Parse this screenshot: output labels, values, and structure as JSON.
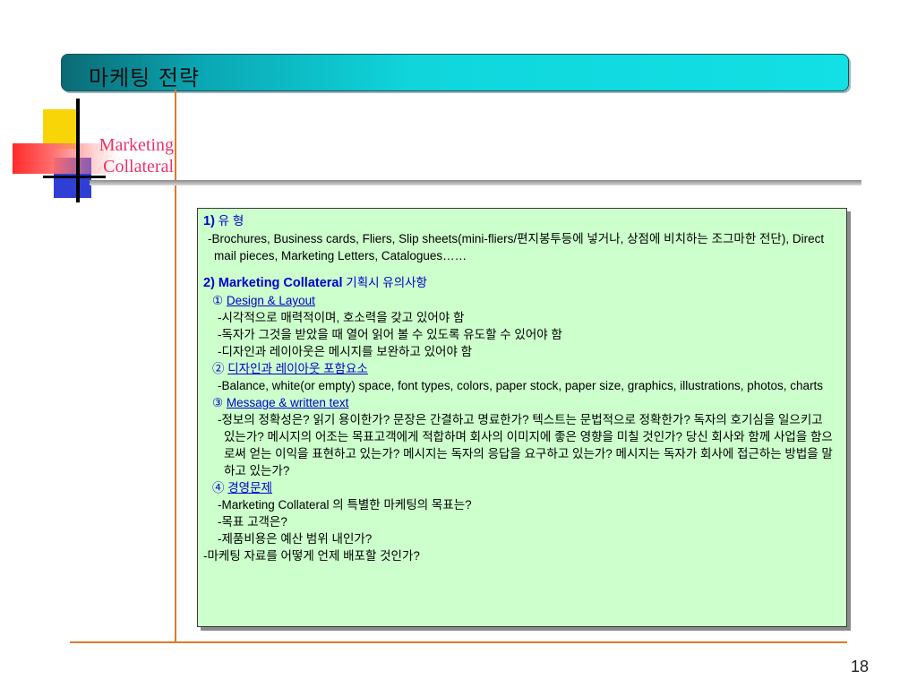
{
  "slide": {
    "title": "마케팅 전략",
    "logo_line1": "Marketing",
    "logo_line2": "Collateral",
    "page_number": "18"
  },
  "content": {
    "s1_num": "1)",
    "s1_title": "유  형",
    "s1_body": "-Brochures, Business cards, Fliers, Slip sheets(mini-fliers/편지봉투등에 넣거나, 상점에 비치하는 조그마한 전단), Direct mail pieces, Marketing Letters, Catalogues……",
    "s2_title": "2) Marketing Collateral",
    "s2_title_k": "기획시 유의사항",
    "sub1_num": "①",
    "sub1_label": "Design & Layout",
    "sub1_lines": [
      "-시각적으로 매력적이며, 호소력을 갖고 있어야 함",
      "-독자가 그것을 받았을 때 열어 읽어 볼 수 있도록 유도할 수 있어야 함",
      "-디자인과 레이아웃은 메시지를 보완하고 있어야 함"
    ],
    "sub2_num": "②",
    "sub2_label": "디자인과 레이아웃 포함요소",
    "sub2_body": "-Balance, white(or empty) space, font types, colors, paper stock, paper size, graphics, illustrations, photos, charts",
    "sub3_num": "③",
    "sub3_label": "Message & written text",
    "sub3_body": "-정보의 정확성은? 읽기 용이한가? 문장은 간결하고 명료한가? 텍스트는 문법적으로 정확한가? 독자의 호기심을 일으키고 있는가? 메시지의 어조는 목표고객에게 적합하며 회사의 이미지에 좋은 영향을 미칠 것인가? 당신 회사와 함께 사업을 함으로써 얻는 이익을 표현하고 있는가? 메시지는 독자의 응답을 요구하고 있는가? 메시지는 독자가 회사에 접근하는 방법을 말하고 있는가?",
    "sub4_num": "④",
    "sub4_label": "경영문제",
    "sub4_lines": [
      "-Marketing Collateral 의 특별한 마케팅의 목표는?",
      "-목표 고객은?",
      "-제품비용은 예산 범위 내인가?"
    ],
    "last_line": "-마케팅 자료를 어떻게 언제 배포할 것인가?"
  }
}
